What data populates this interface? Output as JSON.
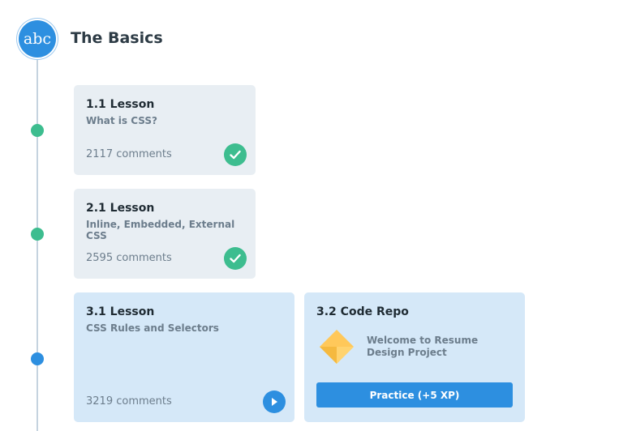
{
  "section": {
    "badge_text": "abc",
    "title": "The Basics"
  },
  "lessons": [
    {
      "title": "1.1 Lesson",
      "subtitle": "What is CSS?",
      "comments": "2117 comments",
      "status": "completed"
    },
    {
      "title": "2.1 Lesson",
      "subtitle": "Inline, Embedded, External CSS",
      "comments": "2595 comments",
      "status": "completed"
    },
    {
      "title": "3.1 Lesson",
      "subtitle": "CSS Rules and Selectors",
      "comments": "3219 comments",
      "status": "current"
    }
  ],
  "code_repo": {
    "title": "3.2 Code Repo",
    "description": "Welcome to Resume Design Project",
    "button_label": "Practice (+5 XP)"
  },
  "colors": {
    "accent": "#2d8fe0",
    "completed": "#3dbd8f",
    "repo_icon": "#ffc85a"
  }
}
